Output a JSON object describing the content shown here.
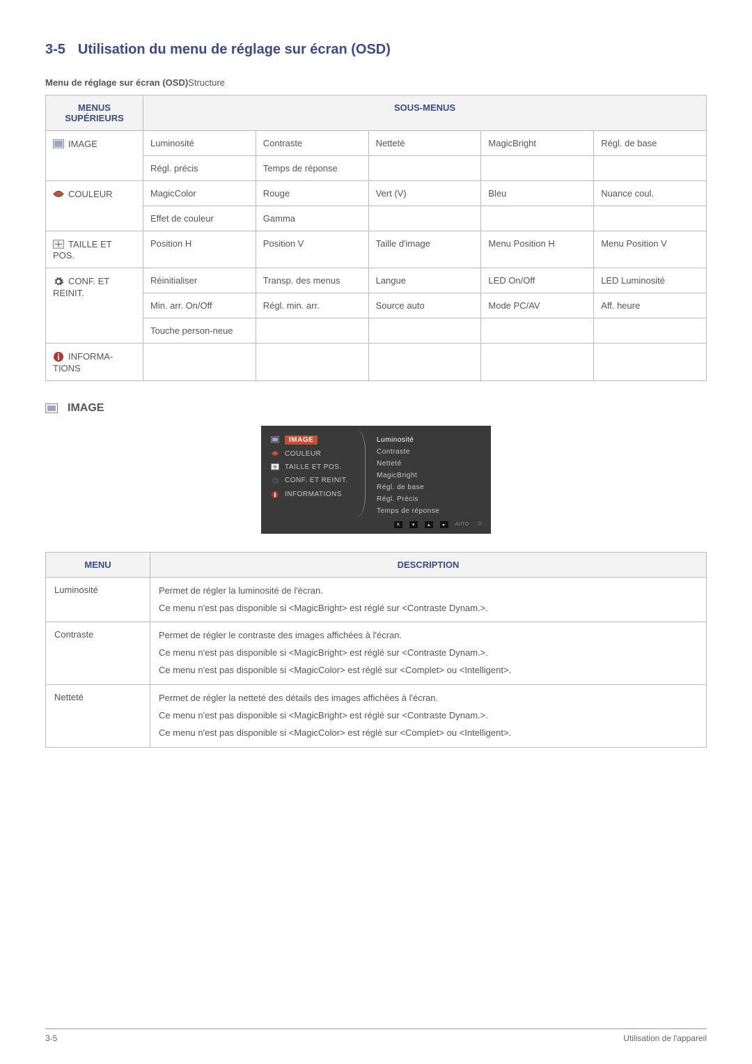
{
  "section": {
    "number": "3-5",
    "title": "Utilisation du menu de réglage sur écran (OSD)"
  },
  "structure_caption": {
    "bold": "Menu de réglage sur écran (OSD)",
    "rest": "Structure"
  },
  "struct_headers": {
    "upper": "MENUS SUPÉRIEURS",
    "sub": "SOUS-MENUS"
  },
  "struct_rows": [
    {
      "icon": "image-icon",
      "label": "IMAGE",
      "subs": [
        "Luminosité",
        "Contraste",
        "Netteté",
        "MagicBright",
        "Régl. de base",
        "Régl. précis",
        "Temps de réponse",
        "",
        "",
        ""
      ]
    },
    {
      "icon": "color-icon",
      "label": "COULEUR",
      "subs": [
        "MagicColor",
        "Rouge",
        "Vert (V)",
        "Bleu",
        "Nuance coul.",
        "Effet de couleur",
        "Gamma",
        "",
        "",
        ""
      ]
    },
    {
      "icon": "size-icon",
      "label": "TAILLE ET POS.",
      "subs": [
        "Position H",
        "Position V",
        "Taille d'image",
        "Menu Position H",
        "Menu Position V"
      ]
    },
    {
      "icon": "gear-icon",
      "label": "CONF. ET REINIT.",
      "subs": [
        "Réinitialiser",
        "Transp. des menus",
        "Langue",
        "LED On/Off",
        "LED Luminosité",
        "Min. arr. On/Off",
        "Régl. min. arr.",
        "Source auto",
        "Mode PC/AV",
        "Aff. heure",
        "Touche person-neue",
        "",
        "",
        "",
        ""
      ]
    },
    {
      "icon": "info-icon",
      "label": "INFORMA-TIONS",
      "subs": [
        "",
        "",
        "",
        "",
        ""
      ]
    }
  ],
  "image_heading": "IMAGE",
  "osd": {
    "left": [
      {
        "icon": "image-icon",
        "label": "IMAGE",
        "active": true
      },
      {
        "icon": "color-icon",
        "label": "COULEUR"
      },
      {
        "icon": "size-icon",
        "label": "TAILLE ET POS."
      },
      {
        "icon": "gear-icon",
        "label": "CONF. ET REINIT."
      },
      {
        "icon": "info-icon",
        "label": "INFORMATIONS"
      }
    ],
    "right": [
      "Luminosité",
      "Contraste",
      "Netteté",
      "MagicBright",
      "Régl. de base",
      "Régl. Précis",
      "Temps de réponse"
    ],
    "footer_auto": "AUTO"
  },
  "desc_headers": {
    "menu": "MENU",
    "desc": "DESCRIPTION"
  },
  "desc_rows": [
    {
      "menu": "Luminosité",
      "lines": [
        "Permet de régler la luminosité de l'écran.",
        "Ce menu n'est pas disponible si <MagicBright> est réglé sur <Contraste Dynam.>."
      ]
    },
    {
      "menu": "Contraste",
      "lines": [
        "Permet de régler le contraste des images affichées à l'écran.",
        "Ce menu n'est pas disponible si <MagicBright> est réglé sur <Contraste Dynam.>.",
        "Ce menu n'est pas disponible si <MagicColor> est réglé sur <Complet> ou <Intelligent>."
      ]
    },
    {
      "menu": "Netteté",
      "lines": [
        "Permet de régler la netteté des détails des images affichées à l'écran.",
        "Ce menu n'est pas disponible si <MagicBright> est réglé sur <Contraste Dynam.>.",
        "Ce menu n'est pas disponible si <MagicColor> est réglé sur <Complet> ou <Intelligent>."
      ]
    }
  ],
  "footer": {
    "left": "3-5",
    "right": "Utilisation de l'appareil"
  }
}
